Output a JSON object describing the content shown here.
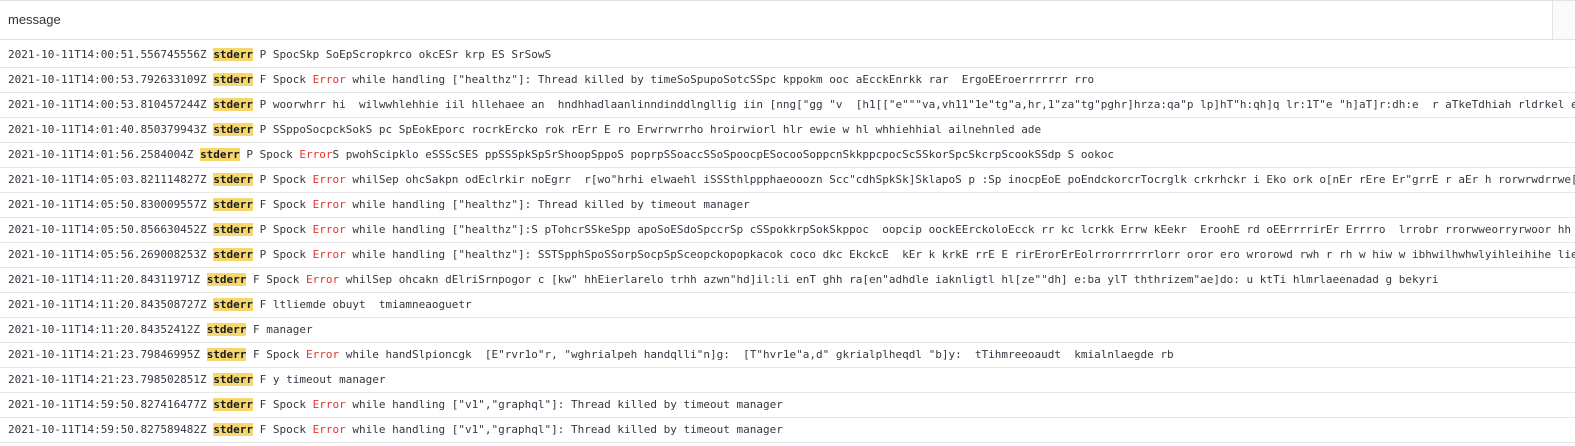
{
  "header": {
    "column_label": "message"
  },
  "rows": [
    [
      {
        "t": "2021-10-11T14:00:51.556745556Z "
      },
      {
        "t": "stderr",
        "c": "hl"
      },
      {
        "t": " P SpocSkp SoEpScropkrco okcESr krp ES SrSowS"
      }
    ],
    [
      {
        "t": "2021-10-11T14:00:53.792633109Z "
      },
      {
        "t": "stderr",
        "c": "hl"
      },
      {
        "t": " F Spock "
      },
      {
        "t": "Error",
        "c": "err"
      },
      {
        "t": " while handling [\"healthz\"]: Thread killed by timeSoSpupoSotcSSpc kppokm ooc aEcckEnrkk rar  ErgoEEroerrrrrrr rro"
      }
    ],
    [
      {
        "t": "2021-10-11T14:00:53.810457244Z "
      },
      {
        "t": "stderr",
        "c": "hl"
      },
      {
        "t": " P woorwhrr hi  wilwwhlehhie iil hllehaee an  hndhhadlaanlinndinddlngllig iin [nng[\"gg \"v  [h1[[\"e\"\"\"va,vh11\"1e\"tg\"a,hr,1\"za\"tg\"pghr]hrza:qa\"p lp]hT\"h:qh]q lr:1T\"e \"h]aT]r:dh:e  r aTkeTdhiah rldrkel ei"
      }
    ],
    [
      {
        "t": "2021-10-11T14:01:40.850379943Z "
      },
      {
        "t": "stderr",
        "c": "hl"
      },
      {
        "t": " P SSppoSocpckSokS pc SpEokEporc rocrkErcko rok rErr E ro Erwrrwrrho hroirwiorl hlr ewie w hl whhiehhial ailnehnled ade"
      }
    ],
    [
      {
        "t": "2021-10-11T14:01:56.2584004Z "
      },
      {
        "t": "stderr",
        "c": "hl"
      },
      {
        "t": " P Spock "
      },
      {
        "t": "Error",
        "c": "err"
      },
      {
        "t": "S pwohScipklo eSSScSES ppSSSpkSpSrShoopSppoS poprpSSoaccSSoSpoocpESocooSoppcnSkkppcpocScSSkorSpcSkcrpScookSSdp S ookoc"
      }
    ],
    [
      {
        "t": "2021-10-11T14:05:03.821114827Z "
      },
      {
        "t": "stderr",
        "c": "hl"
      },
      {
        "t": " P Spock "
      },
      {
        "t": "Error",
        "c": "err"
      },
      {
        "t": " whilSep ohcSakpn odEclrkir noEgrr  r[wo\"hrhi elwaehl iSSSthlppphaeooozn Scc\"cdhSpkSk]SklapoS p :Sp inocpEoE poEndckorcrTocrglk crkrhckr i Eko ork o[nEr rEre Er\"grrE r aEr h rorwrwdrrwe[d"
      }
    ],
    [
      {
        "t": "2021-10-11T14:05:50.830009557Z "
      },
      {
        "t": "stderr",
        "c": "hl"
      },
      {
        "t": " F Spock "
      },
      {
        "t": "Error",
        "c": "err"
      },
      {
        "t": " while handling [\"healthz\"]: Thread killed by timeout manager"
      }
    ],
    [
      {
        "t": "2021-10-11T14:05:50.856630452Z "
      },
      {
        "t": "stderr",
        "c": "hl"
      },
      {
        "t": " P Spock "
      },
      {
        "t": "Error",
        "c": "err"
      },
      {
        "t": " while handling [\"healthz\"]:S pTohcrSSkeSpp apoSoESdoSpccrSp cSSpokkrpSokSkppoc  oopcip oockEErckoloEcck rr kc lcrkk Errw kEekr  EroohE rd oEErrrrirEr Errrro  lrrobr rrorwweorryrwoor hh r"
      }
    ],
    [
      {
        "t": "2021-10-11T14:05:56.269008253Z "
      },
      {
        "t": "stderr",
        "c": "hl"
      },
      {
        "t": " P Spock "
      },
      {
        "t": "Error",
        "c": "err"
      },
      {
        "t": " while handling [\"healthz\"]: SSTSpphSpoSSorpSocpSpSceopckopopkacok coco dkc EkckcE  kEr k krkE rrE E rirErorErEolrrorrrrrrlorr oror ero wrorowd rwh r rh w hiw w ibhwilhwhwlyihleihihe lie"
      }
    ],
    [
      {
        "t": "2021-10-11T14:11:20.84311971Z "
      },
      {
        "t": "stderr",
        "c": "hl"
      },
      {
        "t": " F Spock "
      },
      {
        "t": "Error",
        "c": "err"
      },
      {
        "t": " whilSep ohcakn dElriSrnpogor c [kw\" hhEierlarelo trhh azwn\"hd]il:li enT ghh ra[en\"adhdle iaknligtl hl[ze\"\"dh] e:ba ylT ththrizem\"ae]do: u ktTi hlmrlaeenadad g bekyri"
      }
    ],
    [
      {
        "t": "2021-10-11T14:11:20.843508727Z "
      },
      {
        "t": "stderr",
        "c": "hl"
      },
      {
        "t": " F ltliemde obuyt  tmiamneaoguetr"
      }
    ],
    [
      {
        "t": "2021-10-11T14:11:20.84352412Z "
      },
      {
        "t": "stderr",
        "c": "hl"
      },
      {
        "t": " F manager"
      }
    ],
    [
      {
        "t": "2021-10-11T14:21:23.79846995Z "
      },
      {
        "t": "stderr",
        "c": "hl"
      },
      {
        "t": " F Spock "
      },
      {
        "t": "Error",
        "c": "err"
      },
      {
        "t": " while handSlpioncgk  [E\"rvr1o\"r, \"wghrialpeh handqlli\"n]g:  [T\"hvr1e\"a,d\" gkrialplheqdl \"b]y:  tTihmreeoaudt  kmialnlaegde rb"
      }
    ],
    [
      {
        "t": "2021-10-11T14:21:23.798502851Z "
      },
      {
        "t": "stderr",
        "c": "hl"
      },
      {
        "t": " F y timeout manager"
      }
    ],
    [
      {
        "t": "2021-10-11T14:59:50.827416477Z "
      },
      {
        "t": "stderr",
        "c": "hl"
      },
      {
        "t": " F Spock "
      },
      {
        "t": "Error",
        "c": "err"
      },
      {
        "t": " while handling [\"v1\",\"graphql\"]: Thread killed by timeout manager"
      }
    ],
    [
      {
        "t": "2021-10-11T14:59:50.827589482Z "
      },
      {
        "t": "stderr",
        "c": "hl"
      },
      {
        "t": " F Spock "
      },
      {
        "t": "Error",
        "c": "err"
      },
      {
        "t": " while handling [\"v1\",\"graphql\"]: Thread killed by timeout manager"
      }
    ]
  ]
}
